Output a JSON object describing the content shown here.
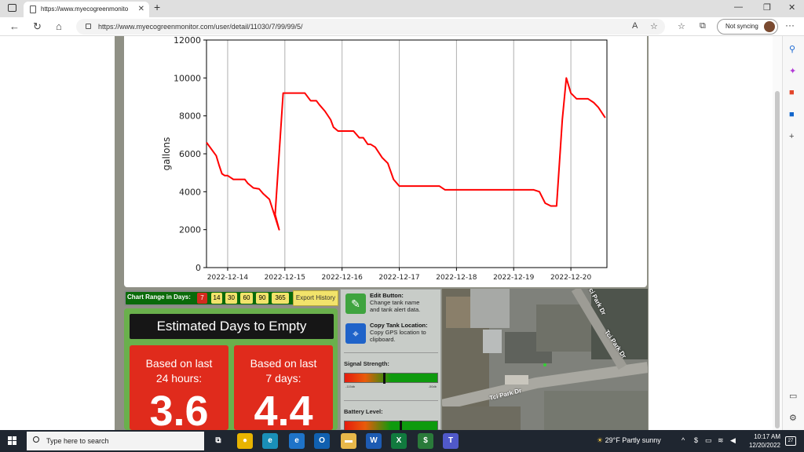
{
  "browser": {
    "tab_title": "https://www.myecogreenmonito",
    "url": "https://www.myecogreenmonitor.com/user/detail/11030/7/99/99/5/",
    "sync_label": "Not syncing"
  },
  "chart_data": {
    "type": "line",
    "ylabel": "gallons",
    "xlabel": "",
    "ylim": [
      0,
      12000
    ],
    "yticks": [
      "0",
      "2000",
      "4000",
      "6000",
      "8000",
      "10000",
      "12000"
    ],
    "xticks": [
      "2022-12-14",
      "2022-12-15",
      "2022-12-16",
      "2022-12-17",
      "2022-12-18",
      "2022-12-19",
      "2022-12-20"
    ],
    "series": [
      {
        "color": "#ff0000",
        "x": [
          13.63,
          13.8,
          13.85,
          13.9,
          13.95,
          14.0,
          14.05,
          14.1,
          14.3,
          14.35,
          14.45,
          14.55,
          14.62,
          14.73,
          14.9,
          14.83,
          14.97,
          15.35,
          15.45,
          15.55,
          15.6,
          15.7,
          15.8,
          15.85,
          15.93,
          16.1,
          16.2,
          16.3,
          16.37,
          16.45,
          16.5,
          16.58,
          16.7,
          16.8,
          16.9,
          17.0,
          17.7,
          17.8,
          19.35,
          19.45,
          19.55,
          19.65,
          19.75,
          19.85,
          19.92,
          20.0,
          20.1,
          20.2,
          20.3,
          20.4,
          20.48,
          20.6
        ],
        "y": [
          6600,
          5900,
          5400,
          4950,
          4850,
          4850,
          4750,
          4650,
          4650,
          4450,
          4200,
          4150,
          3900,
          3600,
          2000,
          2800,
          9200,
          9200,
          8800,
          8800,
          8600,
          8250,
          7800,
          7400,
          7200,
          7200,
          7200,
          6850,
          6850,
          6500,
          6500,
          6350,
          5800,
          5500,
          4650,
          4300,
          4300,
          4100,
          4100,
          4000,
          3400,
          3250,
          3250,
          7800,
          10000,
          9200,
          8900,
          8900,
          8900,
          8700,
          8450,
          7900
        ]
      }
    ]
  },
  "range": {
    "label": "Chart Range in Days:",
    "buttons": [
      "7",
      "14",
      "30",
      "60",
      "90",
      "365"
    ],
    "export_label": "Export History"
  },
  "estimate": {
    "title": "Estimated Days to Empty",
    "cards": [
      {
        "label_line1": "Based on last",
        "label_line2": "24 hours:",
        "value": "3.6"
      },
      {
        "label_line1": "Based on last",
        "label_line2": "7 days:",
        "value": "4.4"
      }
    ]
  },
  "panel": {
    "edit_title": "Edit Button:",
    "edit_desc1": "Change tank name",
    "edit_desc2": "and tank alert data.",
    "copy_title": "Copy Tank Location:",
    "copy_desc1": "Copy GPS location to",
    "copy_desc2": "clipboard.",
    "signal_label": "Signal Strength:",
    "signal_fraction": 0.42,
    "signal_scale_left": "-115db",
    "signal_scale_right": "-50db",
    "battery_label": "Battery Level:",
    "battery_fraction": 0.6
  },
  "map": {
    "labels": [
      "Tci Park Dr",
      "Tci Park Dr",
      "Tci Park Dr"
    ]
  },
  "taskbar": {
    "search_placeholder": "Type here to search",
    "weather": "29°F  Partly sunny",
    "time": "10:17 AM",
    "date": "12/20/2022",
    "notif_count": "27"
  }
}
